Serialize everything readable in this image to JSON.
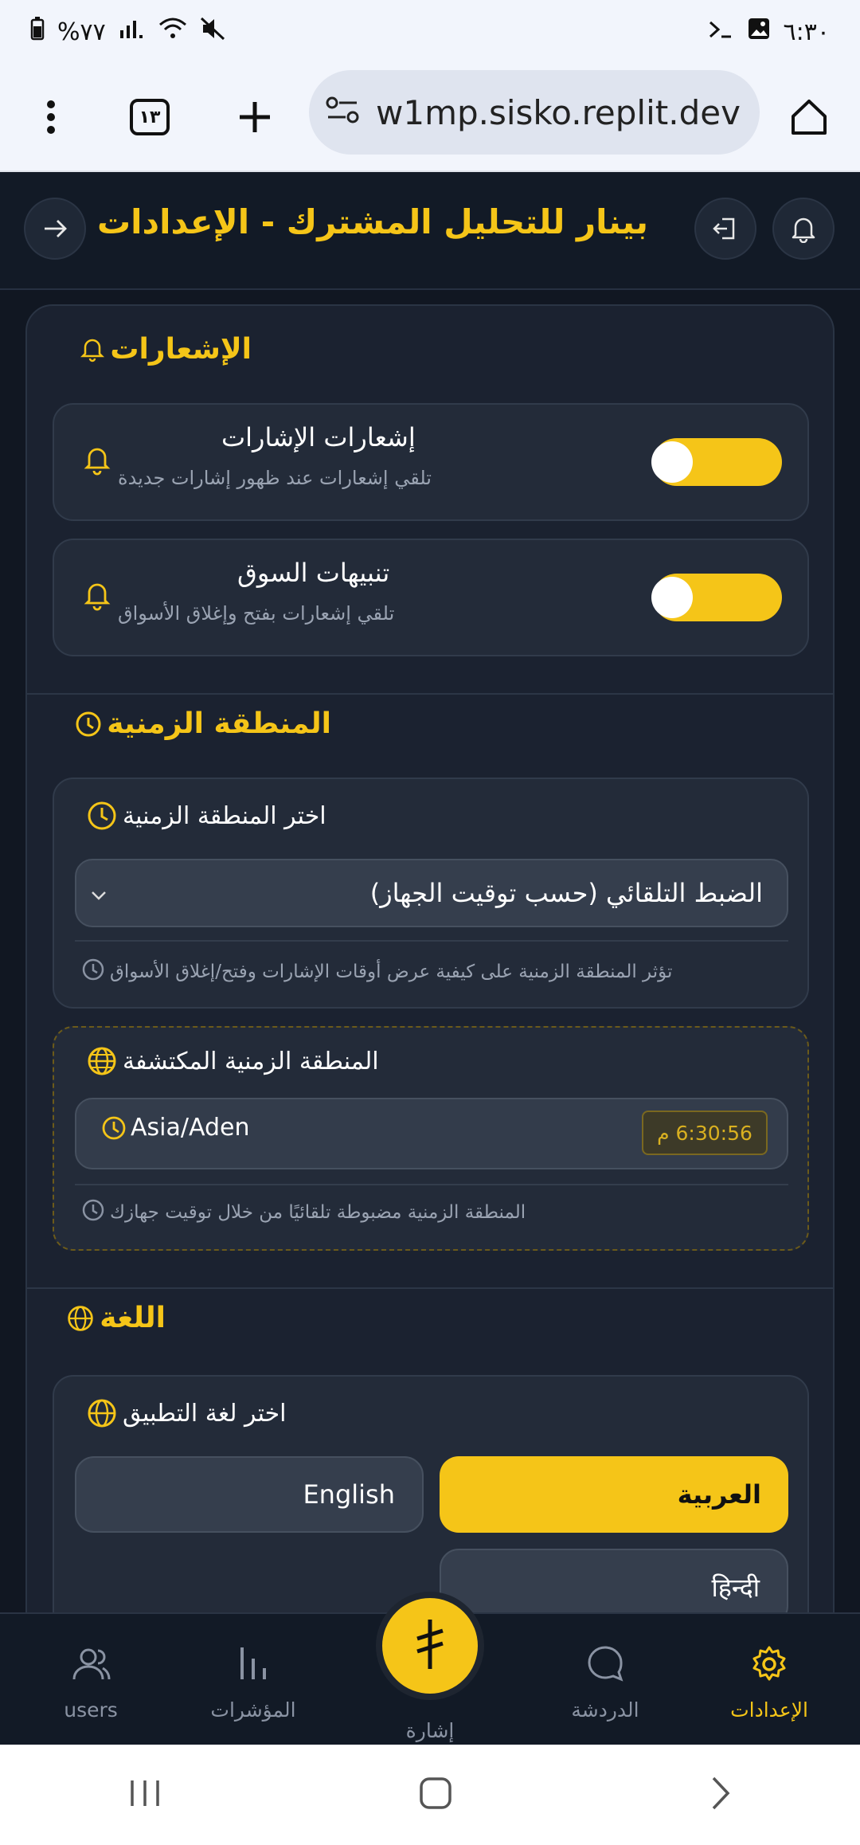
{
  "status_bar": {
    "time": "٦:٣٠",
    "battery": "%٧٧"
  },
  "browser": {
    "tab_count": "١٣",
    "url": "w1mp.sisko.replit.dev"
  },
  "header": {
    "title": "بينار للتحليل المشترك - الإعدادات"
  },
  "notifications": {
    "section_title": "الإشعارات",
    "items": [
      {
        "title": "إشعارات الإشارات",
        "subtitle": "تلقي إشعارات عند ظهور إشارات جديدة",
        "enabled": true
      },
      {
        "title": "تنبيهات السوق",
        "subtitle": "تلقي إشعارات بفتح وإغلاق الأسواق",
        "enabled": true
      }
    ]
  },
  "timezone": {
    "section_title": "المنطقة الزمنية",
    "select_title": "اختر المنطقة الزمنية",
    "selected": "الضبط التلقائي (حسب توقيت الجهاز)",
    "hint": "تؤثر المنطقة الزمنية على كيفية عرض أوقات الإشارات وفتح/إغلاق الأسواق",
    "detected_title": "المنطقة الزمنية المكتشفة",
    "detected_zone": "Asia/Aden",
    "detected_time": "6:30:56 م",
    "detected_hint": "المنطقة الزمنية مضبوطة تلقائيًا من خلال توقيت جهازك"
  },
  "language": {
    "section_title": "اللغة",
    "select_title": "اختر لغة التطبيق",
    "options": [
      "العربية",
      "English",
      "हिन्दी"
    ],
    "selected": "العربية"
  },
  "bottom_nav": {
    "items": [
      "users",
      "المؤشرات",
      "الدردشة",
      "الإعدادات"
    ],
    "center_label": "إشارة",
    "active": "الإعدادات"
  },
  "colors": {
    "accent": "#f5c518",
    "background": "#111722",
    "card": "#232b39"
  }
}
